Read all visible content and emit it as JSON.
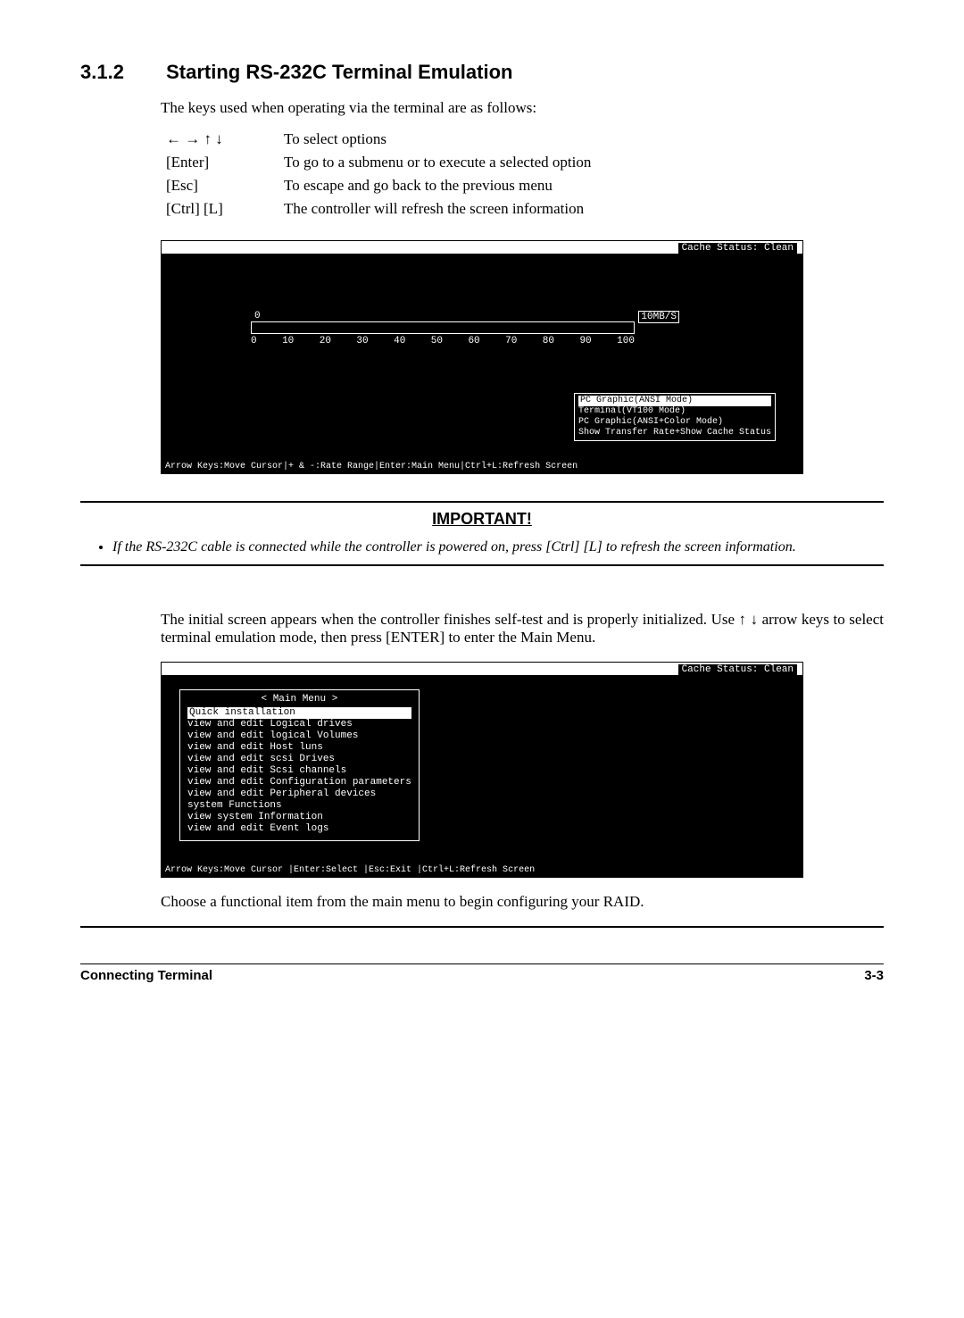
{
  "heading": {
    "number": "3.1.2",
    "title": "Starting RS-232C Terminal Emulation"
  },
  "intro": "The keys used when operating via the terminal are as follows:",
  "keys": [
    {
      "k": "← → ↑ ↓",
      "d": "To select options"
    },
    {
      "k": "[Enter]",
      "d": "To go to a submenu or to execute a selected option"
    },
    {
      "k": "[Esc]",
      "d": "To escape and go back to the previous menu"
    },
    {
      "k": "[Ctrl] [L]",
      "d": "The controller will refresh the screen information"
    }
  ],
  "term1": {
    "cache": "Cache Status: Clean",
    "zero": "0",
    "rate": "10MB/S",
    "ticks": [
      "0",
      "10",
      "20",
      "30",
      "40",
      "50",
      "60",
      "70",
      "80",
      "90",
      "100"
    ],
    "modes": [
      "PC Graphic(ANSI Mode)",
      "Terminal(VT100 Mode)",
      "PC Graphic(ANSI+Color Mode)",
      "Show Transfer Rate+Show Cache Status"
    ],
    "footer": "Arrow Keys:Move Cursor|+ & -:Rate Range|Enter:Main Menu|Ctrl+L:Refresh Screen"
  },
  "important": {
    "title": "IMPORTANT!",
    "note": "If the RS-232C cable is connected while the controller is powered on, press [Ctrl] [L] to refresh the screen information."
  },
  "para2a": "The initial screen appears when the controller finishes self-test and is properly initialized.  Use ↑ ↓ arrow keys to select terminal emulation mode, then press [ENTER] to enter the Main Menu.",
  "term2": {
    "cache": "Cache Status: Clean",
    "menu_title": "< Main Menu >",
    "items": [
      "Quick installation",
      "view and edit Logical drives",
      "view and edit logical Volumes",
      "view and edit Host luns",
      "view and edit scsi Drives",
      "view and edit Scsi channels",
      "view and edit Configuration parameters",
      "view and edit Peripheral devices",
      "system Functions",
      "view system Information",
      "view and edit Event logs"
    ],
    "footer": "Arrow Keys:Move Cursor  |Enter:Select  |Esc:Exit  |Ctrl+L:Refresh Screen"
  },
  "para3": "Choose a functional item from the main menu to begin configuring your RAID.",
  "footer": {
    "left": "Connecting Terminal",
    "right": "3-3"
  }
}
